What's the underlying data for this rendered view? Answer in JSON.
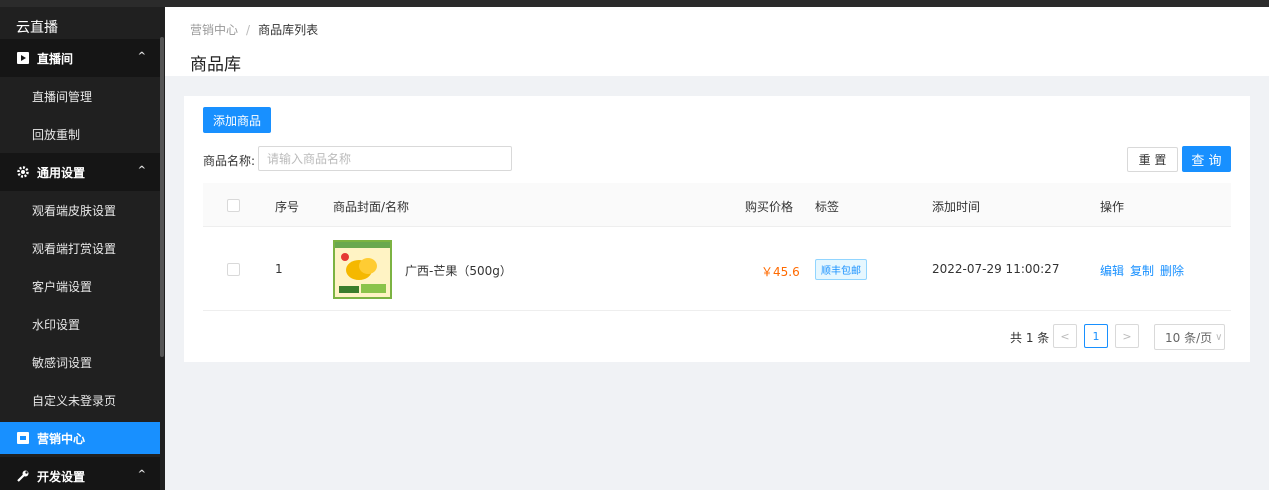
{
  "sidebar": {
    "title": "云直播",
    "groups": [
      {
        "label": "直播间",
        "expanded": true,
        "items": [
          "直播间管理",
          "回放重制"
        ]
      },
      {
        "label": "通用设置",
        "expanded": true,
        "items": [
          "观看端皮肤设置",
          "观看端打赏设置",
          "客户端设置",
          "水印设置",
          "敏感词设置",
          "自定义未登录页"
        ]
      },
      {
        "label": "营销中心",
        "active": true
      },
      {
        "label": "开发设置",
        "expanded": true
      }
    ],
    "chevron": "^",
    "active_color": "#1890ff"
  },
  "breadcrumb": {
    "parent": "营销中心",
    "separator": "/",
    "current": "商品库列表"
  },
  "page_title": "商品库",
  "toolbar": {
    "add_label": "添加商品",
    "reset_label": "重 置",
    "query_label": "查 询"
  },
  "filter": {
    "name_label": "商品名称:",
    "name_placeholder": "请输入商品名称",
    "name_value": ""
  },
  "table": {
    "headers": [
      "序号",
      "商品封面/名称",
      "购买价格",
      "标签",
      "添加时间",
      "操作"
    ],
    "rows": [
      {
        "index": "1",
        "name": "广西-芒果（500g）",
        "price": "￥45.6",
        "tag": "顺丰包邮",
        "time": "2022-07-29 11:00:27",
        "actions": [
          "编辑",
          "复制",
          "删除"
        ]
      }
    ]
  },
  "pagination": {
    "total_text": "共 1 条",
    "prev": "<",
    "current_page": "1",
    "next": ">",
    "page_size": "10 条/页"
  }
}
